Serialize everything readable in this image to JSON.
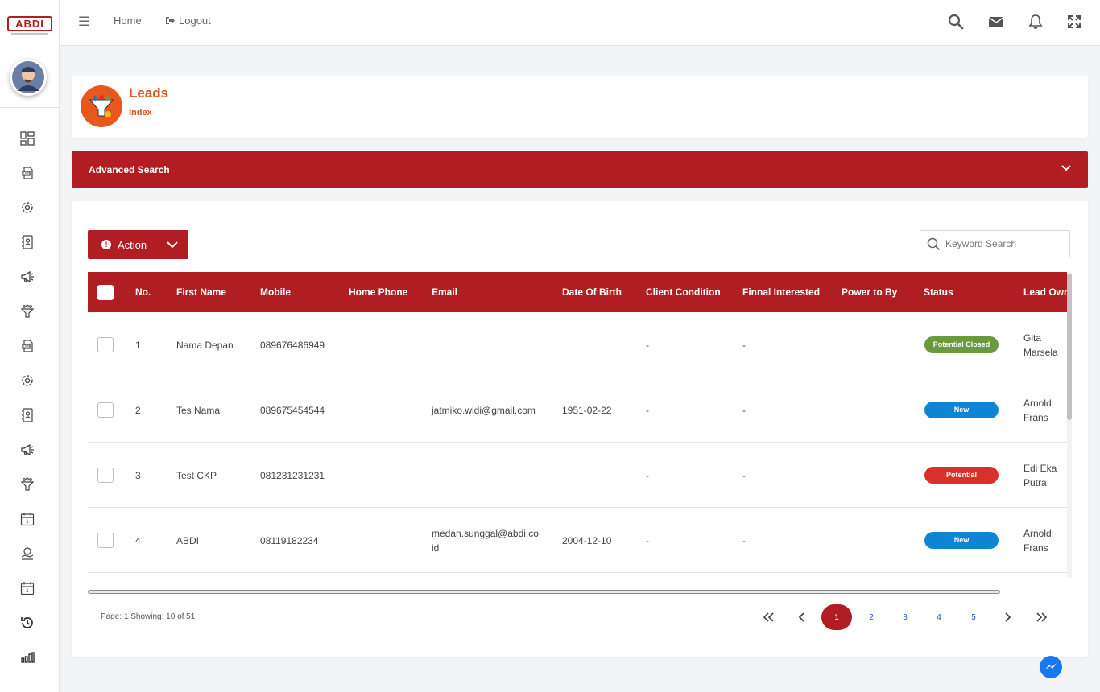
{
  "app": {
    "logo_text": "ABDI"
  },
  "sidebar": {
    "icons": [
      "dashboard-icon",
      "document-icon",
      "gear-icon",
      "contact-book-icon",
      "megaphone-icon",
      "funnel-icon",
      "document-icon",
      "gear-icon",
      "contact-book-icon",
      "megaphone-icon",
      "funnel-icon",
      "calendar-icon",
      "handshake-icon",
      "calendar-icon",
      "history-icon",
      "bar-chart-icon"
    ]
  },
  "topbar": {
    "home": "Home",
    "logout": "Logout"
  },
  "header": {
    "title": "Leads",
    "subtitle": "Index"
  },
  "advanced_search": {
    "label": "Advanced Search"
  },
  "toolbar": {
    "action_label": "Action",
    "search_placeholder": "Keyword Search"
  },
  "table": {
    "columns": [
      "No.",
      "First Name",
      "Mobile",
      "Home Phone",
      "Email",
      "Date Of Birth",
      "Client Condition",
      "Finnal Interested",
      "Power to By",
      "Status",
      "Lead Owner"
    ],
    "rows": [
      {
        "no": "1",
        "first_name": "Nama Depan",
        "mobile": "089676486949",
        "home_phone": "",
        "email": "",
        "email2": "",
        "dob": "",
        "condition": "-",
        "interested": "-",
        "power": "",
        "status": "Potential Closed",
        "status_color": "#6a9a3c",
        "owner1": "Gita",
        "owner2": "Marsela"
      },
      {
        "no": "2",
        "first_name": "Tes Nama",
        "mobile": "089675454544",
        "home_phone": "",
        "email": "jatmiko.widi@gmail.com",
        "email2": "",
        "dob": "1951-02-22",
        "condition": "-",
        "interested": "-",
        "power": "",
        "status": "New",
        "status_color": "#0e84d4",
        "owner1": "Arnold",
        "owner2": "Frans"
      },
      {
        "no": "3",
        "first_name": "Test CKP",
        "mobile": "081231231231",
        "home_phone": "",
        "email": "",
        "email2": "",
        "dob": "",
        "condition": "-",
        "interested": "-",
        "power": "",
        "status": "Potential",
        "status_color": "#d9302c",
        "owner1": "Edi Eka",
        "owner2": "Putra"
      },
      {
        "no": "4",
        "first_name": "ABDI",
        "mobile": "08119182234",
        "home_phone": "",
        "email": "medan.sunggal@abdi.co",
        "email2": "id",
        "dob": "2004-12-10",
        "condition": "-",
        "interested": "-",
        "power": "",
        "status": "New",
        "status_color": "#0e84d4",
        "owner1": "Arnold",
        "owner2": "Frans"
      }
    ]
  },
  "pagination": {
    "info": "Page: 1 Showing: 10 of 51",
    "pages": [
      "1",
      "2",
      "3",
      "4",
      "5"
    ],
    "current": "1"
  },
  "colors": {
    "brand": "#b01e24",
    "accent": "#d9531e"
  }
}
